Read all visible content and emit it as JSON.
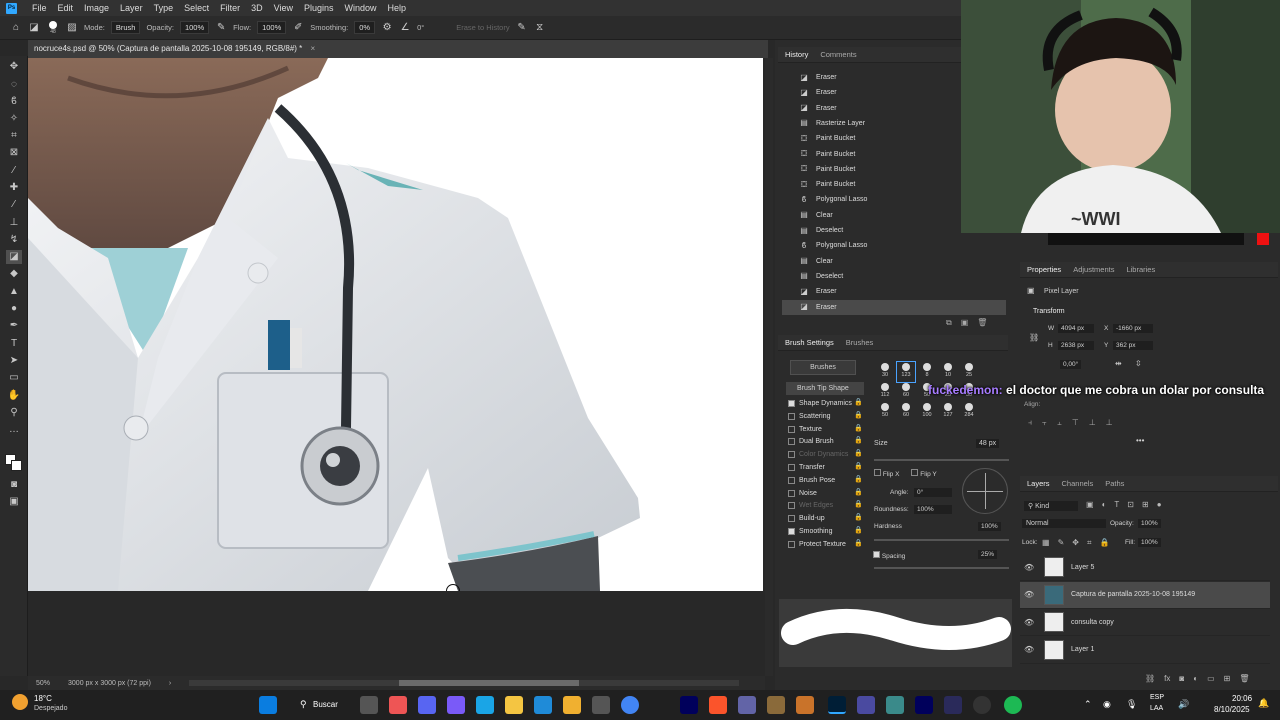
{
  "app": {
    "logo": "Ps"
  },
  "menu": [
    "File",
    "Edit",
    "Image",
    "Layer",
    "Type",
    "Select",
    "Filter",
    "3D",
    "View",
    "Plugins",
    "Window",
    "Help"
  ],
  "options": {
    "brush_size": "48",
    "mode_label": "Mode:",
    "mode_value": "Brush",
    "opacity_label": "Opacity:",
    "opacity_value": "100%",
    "flow_label": "Flow:",
    "flow_value": "100%",
    "smoothing_label": "Smoothing:",
    "smoothing_value": "0%",
    "angle_value": "0°",
    "erase_history": "Erase to History"
  },
  "document": {
    "tab": "nocruce4s.psd @ 50% (Captura de pantalla 2025-10-08 195149, RGB/8#) *",
    "zoom": "50%",
    "size": "3000 px x 3000 px (72 ppi)"
  },
  "history": {
    "tabs": [
      "History",
      "Comments"
    ],
    "items": [
      {
        "icon": "eraser-icon",
        "label": "Eraser"
      },
      {
        "icon": "eraser-icon",
        "label": "Eraser"
      },
      {
        "icon": "eraser-icon",
        "label": "Eraser"
      },
      {
        "icon": "layer-icon",
        "label": "Rasterize Layer"
      },
      {
        "icon": "bucket-icon",
        "label": "Paint Bucket"
      },
      {
        "icon": "bucket-icon",
        "label": "Paint Bucket"
      },
      {
        "icon": "bucket-icon",
        "label": "Paint Bucket"
      },
      {
        "icon": "bucket-icon",
        "label": "Paint Bucket"
      },
      {
        "icon": "lasso-icon",
        "label": "Polygonal Lasso"
      },
      {
        "icon": "layer-icon",
        "label": "Clear"
      },
      {
        "icon": "layer-icon",
        "label": "Deselect"
      },
      {
        "icon": "lasso-icon",
        "label": "Polygonal Lasso"
      },
      {
        "icon": "layer-icon",
        "label": "Clear"
      },
      {
        "icon": "layer-icon",
        "label": "Deselect"
      },
      {
        "icon": "eraser-icon",
        "label": "Eraser"
      },
      {
        "icon": "eraser-icon",
        "label": "Eraser"
      }
    ]
  },
  "brush_settings": {
    "tabs": [
      "Brush Settings",
      "Brushes"
    ],
    "brushes_button": "Brushes",
    "tip_shape": "Brush Tip Shape",
    "options": [
      {
        "label": "Shape Dynamics",
        "checked": true,
        "dim": false
      },
      {
        "label": "Scattering",
        "checked": false,
        "dim": false
      },
      {
        "label": "Texture",
        "checked": false,
        "dim": false
      },
      {
        "label": "Dual Brush",
        "checked": false,
        "dim": false
      },
      {
        "label": "Color Dynamics",
        "checked": false,
        "dim": true
      },
      {
        "label": "Transfer",
        "checked": false,
        "dim": false
      },
      {
        "label": "Brush Pose",
        "checked": false,
        "dim": false
      },
      {
        "label": "Noise",
        "checked": false,
        "dim": false
      },
      {
        "label": "Wet Edges",
        "checked": false,
        "dim": true
      },
      {
        "label": "Build-up",
        "checked": false,
        "dim": false
      },
      {
        "label": "Smoothing",
        "checked": true,
        "dim": false
      },
      {
        "label": "Protect Texture",
        "checked": false,
        "dim": false
      }
    ],
    "tips": [
      "30",
      "123",
      "8",
      "10",
      "25",
      "112",
      "60",
      "50",
      "25",
      "30",
      "50",
      "60",
      "100",
      "127",
      "284"
    ],
    "size_label": "Size",
    "size_value": "48 px",
    "flipx": "Flip X",
    "flipy": "Flip Y",
    "angle_label": "Angle:",
    "angle_value": "0°",
    "roundness_label": "Roundness:",
    "roundness_value": "100%",
    "hardness_label": "Hardness",
    "hardness_value": "100%",
    "spacing_label": "Spacing",
    "spacing_value": "25%"
  },
  "properties": {
    "tabs": [
      "Properties",
      "Adjustments",
      "Libraries"
    ],
    "kind": "Pixel Layer",
    "transform": "Transform",
    "w": "4094 px",
    "h": "2638 px",
    "x": "-1660 px",
    "y": "362 px",
    "angle": "0,00°",
    "align": "Align:"
  },
  "layers": {
    "tabs": [
      "Layers",
      "Channels",
      "Paths"
    ],
    "kind": "Kind",
    "blend": "Normal",
    "opacity_label": "Opacity:",
    "opacity_value": "100%",
    "lock_label": "Lock:",
    "fill_label": "Fill:",
    "fill_value": "100%",
    "items": [
      {
        "name": "Layer 5"
      },
      {
        "name": "Captura de pantalla 2025-10-08 195149"
      },
      {
        "name": "consulta copy"
      },
      {
        "name": "Layer 1"
      }
    ]
  },
  "overlay": {
    "user": "fuckedemon:",
    "message": "el doctor que me cobra un dolar por consulta"
  },
  "taskbar": {
    "weather_temp": "18°C",
    "weather_desc": "Despejado",
    "search": "Buscar",
    "lang1": "ESP",
    "lang2": "LAA",
    "time": "20:06",
    "date": "8/10/2025"
  },
  "colors": {
    "ps_blue": "#31a8ff",
    "selected": "#4a4a4a",
    "accent": "#a77cff"
  }
}
